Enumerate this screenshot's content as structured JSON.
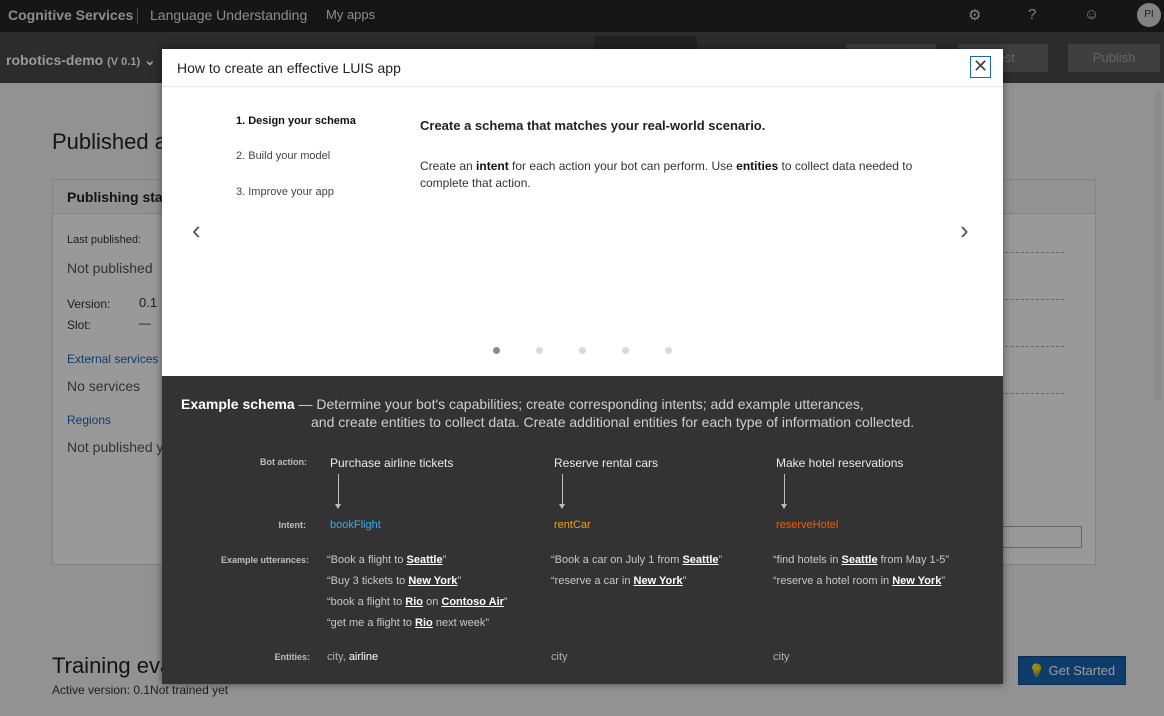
{
  "topnav": {
    "brand": "Cognitive Services",
    "product": "Language Understanding",
    "my_apps": "My apps",
    "icons": [
      "gear-icon",
      "help-icon",
      "smiley-icon"
    ],
    "avatar_initials": "PI"
  },
  "appbar": {
    "app_name": "robotics-demo",
    "version": "(V 0.1)",
    "test_button": "Test",
    "publish_button": "Publish"
  },
  "background": {
    "page_title": "Published a",
    "card_title": "Publishing stat",
    "last_published_label": "Last published:",
    "last_published_value": "Not published",
    "version_label": "Version:",
    "version_value": "0.1",
    "slot_label": "Slot:",
    "slot_value": "—",
    "external_services_link": "External services",
    "external_services_value": "No services",
    "regions_link": "Regions",
    "regions_value": "Not published y",
    "training_title": "Training eva",
    "training_sub": "Active version: 0.1Not trained yet",
    "get_started": "Get Started"
  },
  "dialog": {
    "title": "How to create an effective LUIS app",
    "close_glyph": "✕",
    "steps": [
      "1. Design your schema",
      "2. Build your model",
      "3. Improve your app"
    ],
    "active_step": 0,
    "heading": "Create a schema that matches your real-world scenario.",
    "body_parts": [
      "Create an ",
      "intent",
      " for each action your bot can perform. Use ",
      "entities",
      " to collect data needed to complete that action."
    ],
    "prev_glyph": "‹",
    "next_glyph": "›",
    "dots_total": 5,
    "active_dot": 0
  },
  "example": {
    "title": "Example schema",
    "intro_line1": " — Determine your bot's capabilities; create corresponding intents; add example utterances,",
    "intro_line2": "and create entities to collect data. Create additional entities for each type of information collected.",
    "labels": {
      "bot_action": "Bot action:",
      "intent": "Intent:",
      "utterances": "Example utterances:",
      "entities": "Entities:"
    },
    "columns": [
      {
        "action": "Purchase airline tickets",
        "intent": "bookFlight",
        "intent_color": "#3fa9e0",
        "utterances": [
          [
            "“Book a flight to ",
            {
              "u": "Seattle"
            },
            "”"
          ],
          [
            "“Buy 3 tickets to ",
            {
              "u": "New York"
            },
            "”"
          ],
          [
            "“book a flight to ",
            {
              "u": "Rio"
            },
            " on ",
            {
              "u": "Contoso Air"
            },
            "”"
          ],
          [
            "“get me a flight to ",
            {
              "u": "Rio"
            },
            " next week”"
          ]
        ],
        "entities": [
          "city",
          "airline"
        ]
      },
      {
        "action": "Reserve rental cars",
        "intent": "rentCar",
        "intent_color": "#f0a30a",
        "utterances": [
          [
            "“Book a car on July 1 from ",
            {
              "u": "Seattle"
            },
            "”"
          ],
          [
            "“reserve a car in ",
            {
              "u": "New York"
            },
            "”"
          ]
        ],
        "entities": [
          "city"
        ]
      },
      {
        "action": "Make hotel reservations",
        "intent": "reserveHotel",
        "intent_color": "#e8600f",
        "utterances": [
          [
            "“find hotels in ",
            {
              "u": "Seattle"
            },
            " from May 1-5”"
          ],
          [
            "“reserve a hotel room in ",
            {
              "u": "New York"
            },
            "”"
          ]
        ],
        "entities": [
          "city"
        ]
      }
    ]
  }
}
